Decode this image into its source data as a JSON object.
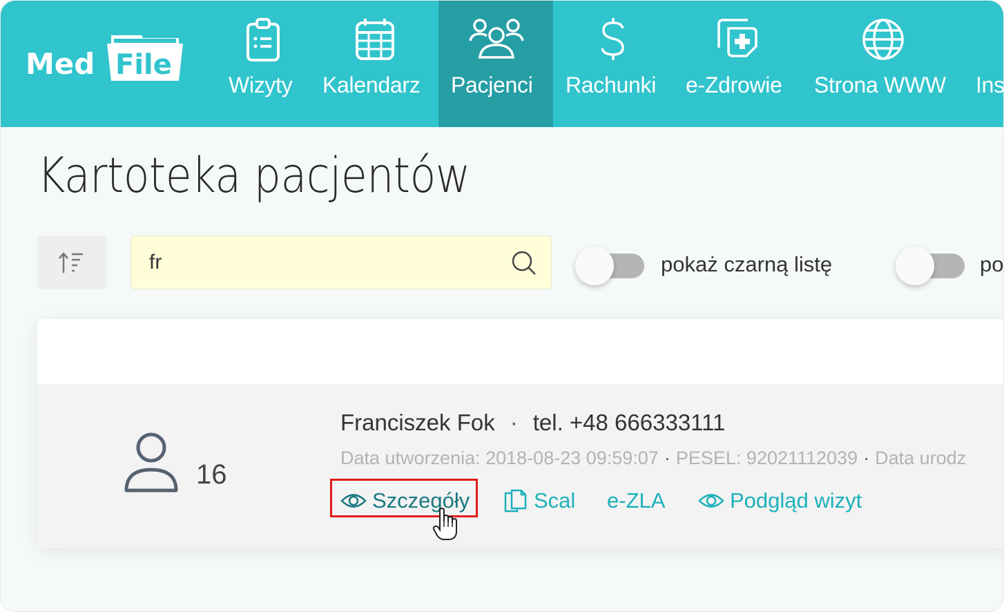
{
  "app": {
    "logo_text_left": "Med",
    "logo_text_right": "File",
    "brand_color": "#30c4cd",
    "active_color": "#259ea4"
  },
  "nav": {
    "items": [
      {
        "label": "Wizyty",
        "icon": "clipboard-icon"
      },
      {
        "label": "Kalendarz",
        "icon": "calendar-icon"
      },
      {
        "label": "Pacjenci",
        "icon": "users-icon",
        "active": true
      },
      {
        "label": "Rachunki",
        "icon": "dollar-icon"
      },
      {
        "label": "e-Zdrowie",
        "icon": "medical-copy-icon"
      },
      {
        "label": "Strona WWW",
        "icon": "globe-icon"
      },
      {
        "label": "Ins",
        "icon": ""
      }
    ]
  },
  "page": {
    "title": "Kartoteka pacjentów"
  },
  "toolbar": {
    "sort_icon": "sort-ascending-icon",
    "search_value": "fr",
    "search_icon": "search-icon",
    "toggles": [
      {
        "label": "pokaż czarną listę",
        "on": false
      },
      {
        "label": "po",
        "on": false
      }
    ]
  },
  "patients": [
    {
      "id": "16",
      "name": "Franciszek Fok",
      "phone": "tel. +48 666333111",
      "created_label": "Data utworzenia:",
      "created_value": "2018-08-23 09:59:07",
      "pesel_label": "PESEL:",
      "pesel_value": "92021112039",
      "birth_label": "Data urodz",
      "actions": [
        {
          "label": "Szczegóły",
          "icon": "eye-icon",
          "highlighted": true
        },
        {
          "label": "Scal",
          "icon": "copy-icon"
        },
        {
          "label": "e-ZLA",
          "icon": ""
        },
        {
          "label": "Podgląd wizyt",
          "icon": "eye-icon"
        }
      ]
    }
  ],
  "separator": "·"
}
